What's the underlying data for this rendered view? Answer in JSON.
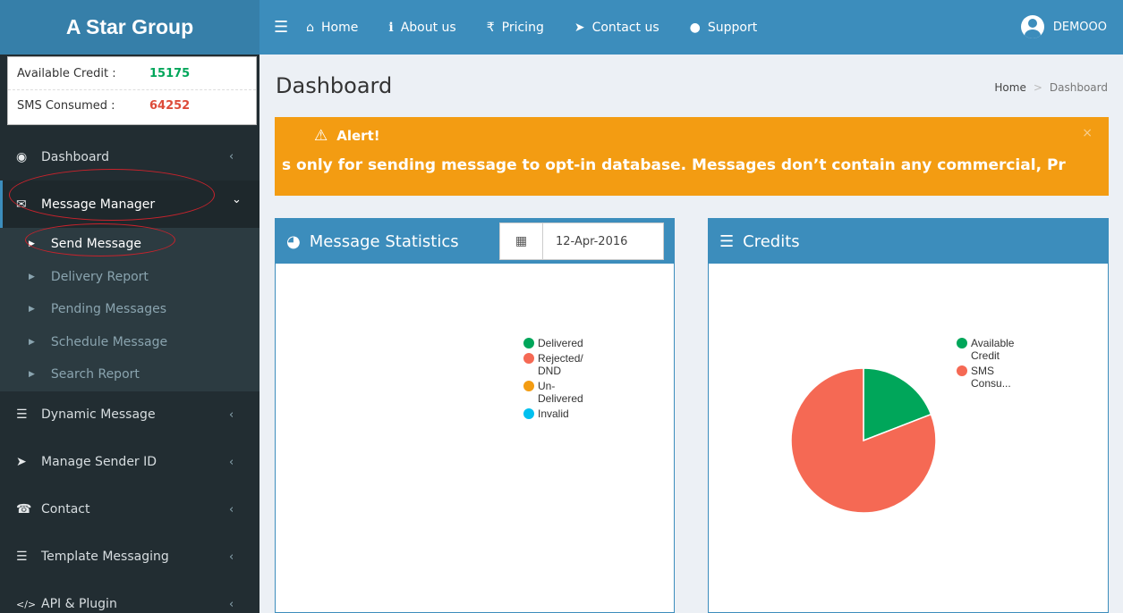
{
  "brand": "A Star Group",
  "nav": {
    "items": [
      {
        "icon": "home-icon",
        "label": "Home"
      },
      {
        "icon": "info-icon",
        "label": "About us"
      },
      {
        "icon": "rupee-icon",
        "label": "Pricing"
      },
      {
        "icon": "paper-plane-icon",
        "label": "Contact us"
      },
      {
        "icon": "chat-bubble-icon",
        "label": "Support"
      }
    ],
    "user": "DEMOOO"
  },
  "sidebar": {
    "credit": {
      "available_label": "Available Credit :",
      "available_value": "15175",
      "consumed_label": "SMS Consumed :",
      "consumed_value": "64252"
    },
    "menu": [
      {
        "label": "Dashboard",
        "arrow": "‹"
      },
      {
        "label": "Message Manager",
        "arrow": "⌄"
      },
      {
        "label": "Dynamic Message",
        "arrow": "‹"
      },
      {
        "label": "Manage Sender ID",
        "arrow": "‹"
      },
      {
        "label": "Contact",
        "arrow": "‹"
      },
      {
        "label": "Template Messaging",
        "arrow": "‹"
      },
      {
        "label": "API & Plugin",
        "arrow": "‹"
      }
    ],
    "submenu": [
      "Send Message",
      "Delivery Report",
      "Pending Messages",
      "Schedule Message",
      "Search Report"
    ]
  },
  "page": {
    "title": "Dashboard",
    "breadcrumb": {
      "home": "Home",
      "sep": ">",
      "current": "Dashboard"
    }
  },
  "alert": {
    "title": "Alert!",
    "message": "s only for sending message to opt-in database. Messages don’t contain any commercial, Pr",
    "close": "×"
  },
  "stats_box": {
    "title": "Message Statistics",
    "date": "12-Apr-2016",
    "legend": [
      "Delivered",
      "Rejected/ DND",
      "Un- Delivered",
      "Invalid"
    ]
  },
  "credits_box": {
    "title": "Credits",
    "legend": [
      "Available Credit",
      "SMS Consu..."
    ]
  },
  "colors": {
    "header": "#3c8dbc",
    "logo": "#367fa9",
    "sidebar": "#222d32",
    "alert": "#f39c12",
    "available_value": "#00a65a",
    "consumed_value": "#dd4b39",
    "delivered": "#00a65a",
    "rejected": "#f56954",
    "undelivered": "#f39c12",
    "invalid": "#00c0ef"
  },
  "chart_data": {
    "type": "pie",
    "categories": [
      "Available Credit",
      "SMS Consumed"
    ],
    "values": [
      15175,
      64252
    ],
    "colors": [
      "#00a65a",
      "#f56954"
    ]
  }
}
